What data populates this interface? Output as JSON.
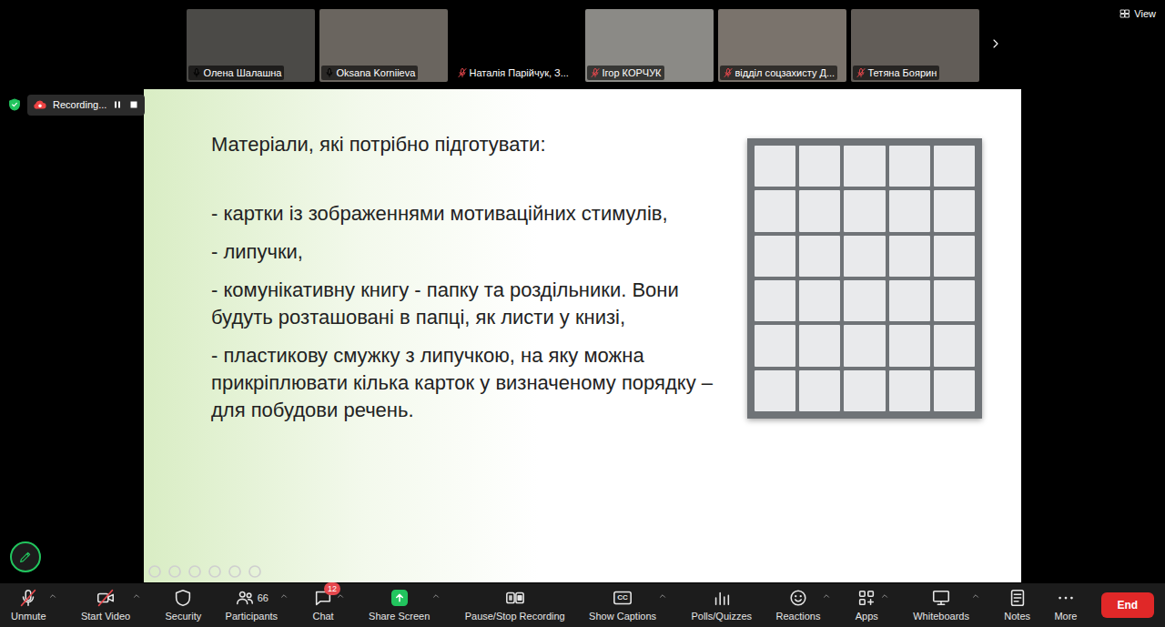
{
  "participants": [
    {
      "name": "Олена Шалашна",
      "muted": false
    },
    {
      "name": "Oksana Korniieva",
      "muted": false
    },
    {
      "name": "Наталія Парійчук, З...",
      "muted": true
    },
    {
      "name": "Ігор КОРЧУК",
      "muted": true
    },
    {
      "name": "відділ соцзахисту Д...",
      "muted": true
    },
    {
      "name": "Тетяна Боярин",
      "muted": true
    }
  ],
  "view_button": {
    "label": "View"
  },
  "recording": {
    "label": "Recording...",
    "paused": false
  },
  "slide": {
    "title": "Матеріали, які потрібно підготувати:",
    "bullets": [
      "- картки із зображеннями мотиваційних стимулів,",
      "- липучки,",
      "- комунікативну книгу - папку та роздільники. Вони будуть розташовані в папці, як листи у книзі,",
      "- пластикову смужку з липучкою, на яку можна прикріплювати кілька карток у визначеному порядку – для побудови речень."
    ]
  },
  "toolbar": [
    {
      "label": "Unmute",
      "kind": "mic",
      "off": true,
      "menu": true
    },
    {
      "label": "Start Video",
      "kind": "video",
      "off": true,
      "menu": true
    },
    {
      "label": "Security",
      "kind": "shield",
      "off": false,
      "menu": false
    },
    {
      "label": "Participants",
      "kind": "people",
      "off": false,
      "menu": true,
      "count": "66"
    },
    {
      "label": "Chat",
      "kind": "chat",
      "off": false,
      "menu": true,
      "badge": "12"
    },
    {
      "label": "Share Screen",
      "kind": "share",
      "off": false,
      "menu": true
    },
    {
      "label": "Pause/Stop Recording",
      "kind": "record",
      "off": false,
      "menu": false
    },
    {
      "label": "Show Captions",
      "kind": "cc",
      "off": false,
      "menu": true,
      "icon_text": "CC"
    },
    {
      "label": "Polls/Quizzes",
      "kind": "poll",
      "off": false,
      "menu": false
    },
    {
      "label": "Reactions",
      "kind": "smile",
      "off": false,
      "menu": true
    },
    {
      "label": "Apps",
      "kind": "apps",
      "off": false,
      "menu": true
    },
    {
      "label": "Whiteboards",
      "kind": "board",
      "off": false,
      "menu": true
    },
    {
      "label": "Notes",
      "kind": "notes",
      "off": false,
      "menu": false
    },
    {
      "label": "More",
      "kind": "more",
      "off": false,
      "menu": false
    }
  ],
  "end_button": {
    "label": "End"
  }
}
